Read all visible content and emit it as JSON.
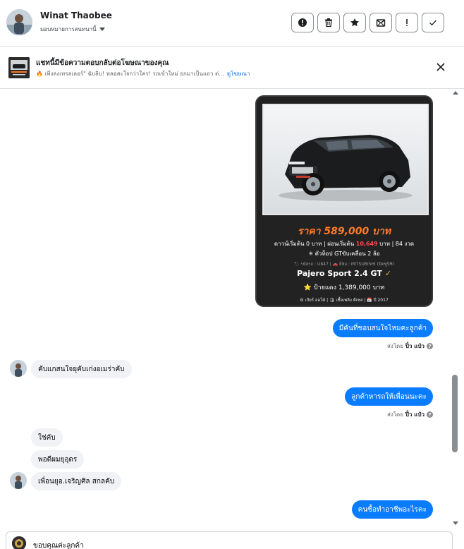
{
  "header": {
    "name": "Winat Thaobee",
    "assign_label": "มอบหมายการสนทนานี้",
    "toolbar": [
      {
        "name": "alert-circle-icon"
      },
      {
        "name": "trash-icon"
      },
      {
        "name": "star-icon"
      },
      {
        "name": "mark-unread-icon"
      },
      {
        "name": "exclamation-icon"
      },
      {
        "name": "checkmark-icon"
      }
    ]
  },
  "ad_notice": {
    "title": "แชทนี้มีข้อความตอบกลับต่อโฆษณาของคุณ",
    "subtitle": "🔥 เพิ่งลงเทรลเลอร์\" ฉับลิบ! หลอสะใจกว่าใคร! รถเข้าใหม่ ยกมาเป็นแถว ต่...",
    "link": "ดูโฆษณา"
  },
  "ad_card": {
    "price": "ราคา 589,000 บาท",
    "line1_a": "ดาวน์เริ่มต้น 0 บาท | ผ่อนเริ่มต้น ",
    "line1_red": "10,649",
    "line1_b": " บาท | 84 งวด",
    "line2": "✳ ตัวท็อป GTขับเคลื่อน 2 ล้อ",
    "meta": "🏷 รหัสรถ : U847 | 🚗 ยี่ห้อ : MITSUBISHI (มิตซูบิชิ)",
    "model": "Pajero Sport 2.4 GT",
    "model_badge": "✓",
    "red_plate": "⭐ ป้ายแดง 1,389,000 บาท",
    "specs": "⚙ เกียร์ ออโต้ | 🛢 เชื้อเพลิง ดีเซล | 📅 ปี 2017"
  },
  "messages": [
    {
      "dir": "out",
      "text": "มีคันที่ชอบสนใจไหมคะลูกค้า"
    },
    {
      "dir": "sent_by",
      "prefix": "ส่งโดย",
      "agent": "ปิ๋ว แป๋ว"
    },
    {
      "dir": "in",
      "text": "คับแกสนใจยุคับเก่งอเมร่าคับ"
    },
    {
      "dir": "out",
      "text": "ลูกค้าหารถให้เพื่อนนะคะ"
    },
    {
      "dir": "sent_by",
      "prefix": "ส่งโดย",
      "agent": "ปิ๋ว แป๋ว"
    },
    {
      "dir": "in",
      "text": "ใช่คับ"
    },
    {
      "dir": "in",
      "text": "พอดีผมยุอุดร"
    },
    {
      "dir": "in",
      "text": "เพื่อนยุอ.เจริญศิล สกลคับ"
    },
    {
      "dir": "out",
      "text": "คนซื้อทำอาชีพอะไรคะ"
    }
  ],
  "composer": {
    "text": "ขอบคุณค่ะลูกค้า"
  },
  "colors": {
    "outgoing_bubble": "#0a7cff",
    "incoming_bubble": "#f0f2f5",
    "link": "#1b74e4",
    "price": "#ff7a2a"
  }
}
